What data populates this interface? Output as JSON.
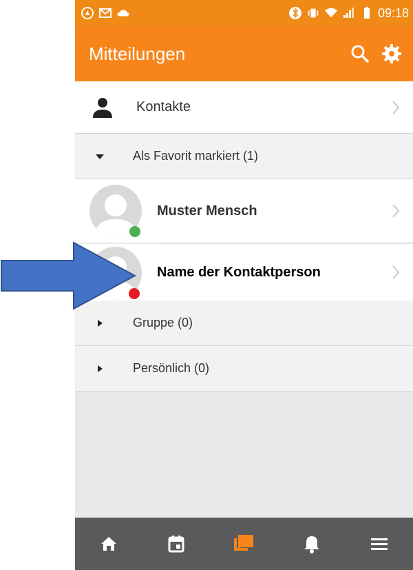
{
  "statusbar": {
    "time": "09:18",
    "left_icons": [
      "app-icon",
      "mail-icon",
      "cloud-icon"
    ],
    "right_icons": [
      "bluetooth-icon",
      "vibrate-icon",
      "wifi-icon",
      "signal-icon",
      "battery-icon"
    ]
  },
  "appbar": {
    "title": "Mitteilungen",
    "actions": [
      "search-icon",
      "settings-gear-icon"
    ]
  },
  "contacts_row": {
    "label": "Kontakte"
  },
  "sections": {
    "favorites": {
      "label": "Als Favorit markiert (1)",
      "expanded": true
    },
    "group": {
      "label": "Gruppe (0)",
      "expanded": false
    },
    "personal": {
      "label": "Persönlich (0)",
      "expanded": false
    }
  },
  "contacts": [
    {
      "name": "Muster Mensch",
      "status_color": "#4caf50"
    },
    {
      "name": "Name der Kontaktperson",
      "status_color": "#e51c23"
    }
  ],
  "bottom_nav": {
    "items": [
      "home-icon",
      "calendar-icon",
      "messages-icon",
      "notifications-icon",
      "menu-icon"
    ],
    "active": "messages-icon",
    "active_color": "#f7851a",
    "inactive_color": "#ffffff"
  },
  "colors": {
    "accent": "#f7851a",
    "statusbar": "#f08a16",
    "overlay_arrow": "#4472c4"
  }
}
